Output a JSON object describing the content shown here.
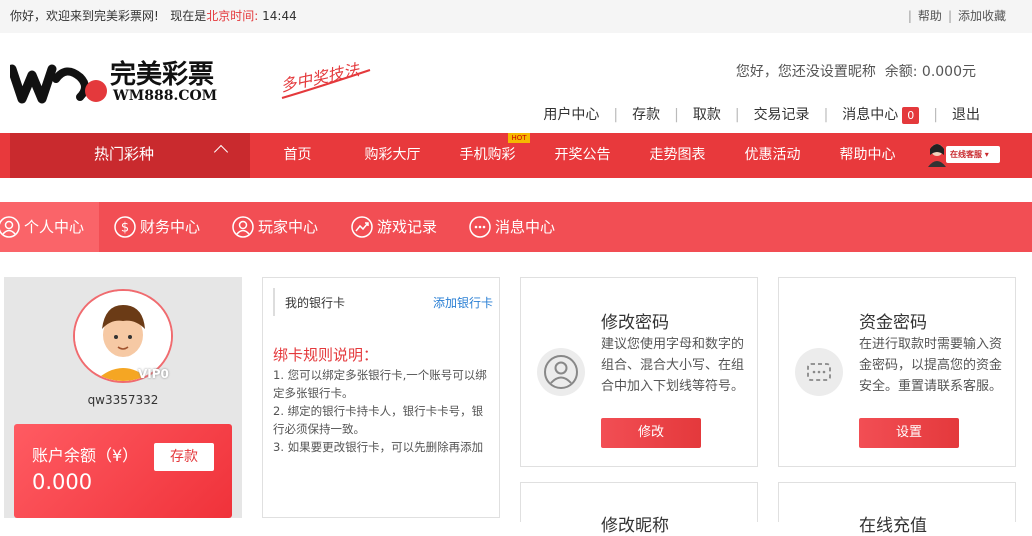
{
  "topbar": {
    "welcome": "你好，欢迎来到完美彩票网!",
    "now_is": "现在是",
    "beijing_time_label": "北京时间:",
    "time": "14:44",
    "help": "帮助",
    "bookmark": "添加收藏"
  },
  "brand": {
    "name": "完美彩票",
    "domain": "WM888.COM",
    "slogan": "多中奖技法"
  },
  "user": {
    "greeting": "您好，",
    "nickname": "您还没设置昵称",
    "balance_label": "余额:",
    "balance": "0.000元",
    "nav": [
      "用户中心",
      "存款",
      "取款",
      "交易记录",
      "消息中心",
      "退出"
    ],
    "message_count": "0"
  },
  "mainnav": {
    "hot": "热门彩种",
    "items": [
      "首页",
      "购彩大厅",
      "手机购彩",
      "开奖公告",
      "走势图表",
      "优惠活动",
      "帮助中心"
    ],
    "hot_tag": "HOT",
    "service": "在线客服"
  },
  "subnav": {
    "items": [
      "个人中心",
      "财务中心",
      "玩家中心",
      "游戏记录",
      "消息中心"
    ]
  },
  "profile": {
    "vip": "VIP0",
    "username": "qw3357332",
    "balance_label": "账户余额（¥）",
    "balance": "0.000",
    "deposit": "存款"
  },
  "bank": {
    "title": "我的银行卡",
    "add": "添加银行卡",
    "rules_title": "绑卡规则说明：",
    "rules": [
      "1. 您可以绑定多张银行卡,一个账号可以绑定多张银行卡。",
      "2. 绑定的银行卡持卡人，银行卡卡号，银行必须保持一致。",
      "3. 如果要更改银行卡，可以先删除再添加"
    ]
  },
  "cards": [
    {
      "title": "修改密码",
      "desc": "建议您使用字母和数字的组合、混合大小写、在组合中加入下划线等符号。",
      "button": "修改",
      "icon": "user-icon"
    },
    {
      "title": "资金密码",
      "desc": "在进行取款时需要输入资金密码，以提高您的资金安全。重置请联系客服。",
      "button": "设置",
      "icon": "password-icon"
    }
  ],
  "lower_cards": [
    "修改昵称",
    "在线充值"
  ],
  "colors": {
    "primary": "#e8393c",
    "dark": "#c92a2e",
    "subnav": "#f24e54"
  }
}
